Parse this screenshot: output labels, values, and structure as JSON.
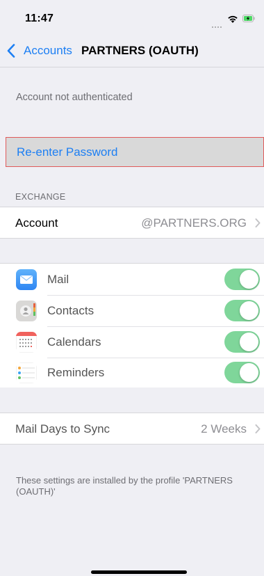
{
  "status_bar": {
    "time": "11:47"
  },
  "nav": {
    "back_label": "Accounts",
    "title": "PARTNERS (OAUTH)"
  },
  "account_status": "Account not authenticated",
  "reenter_password": "Re-enter Password",
  "exchange": {
    "header": "EXCHANGE",
    "account_label": "Account",
    "account_value": "@PARTNERS.ORG"
  },
  "services": [
    {
      "label": "Mail",
      "icon": "mail-icon",
      "enabled": true
    },
    {
      "label": "Contacts",
      "icon": "contacts-icon",
      "enabled": true
    },
    {
      "label": "Calendars",
      "icon": "calendars-icon",
      "enabled": true
    },
    {
      "label": "Reminders",
      "icon": "reminders-icon",
      "enabled": true
    }
  ],
  "mail_days": {
    "label": "Mail Days to Sync",
    "value": "2 Weeks"
  },
  "footer": "These settings are installed by the profile 'PARTNERS (OAUTH)'",
  "colors": {
    "accent": "#1d7ff3",
    "toggle_on": "#7fd69a",
    "background": "#efeff4"
  }
}
